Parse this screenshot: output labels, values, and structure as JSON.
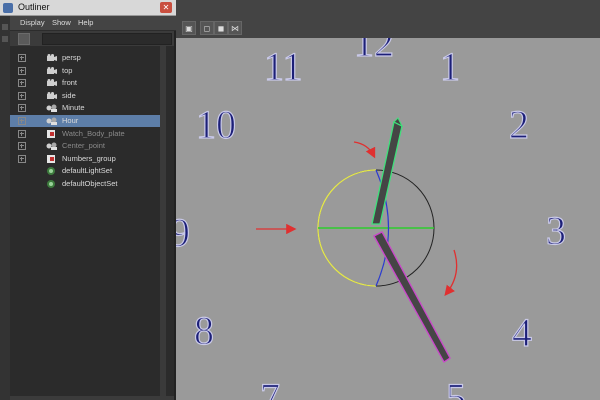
{
  "outliner": {
    "title": "Outliner",
    "close_glyph": "✕",
    "menu": [
      "Display",
      "Show",
      "Help"
    ],
    "items": [
      {
        "label": "persp",
        "icon": "camera-icon",
        "expandable": true,
        "selected": false,
        "dim": false
      },
      {
        "label": "top",
        "icon": "camera-icon",
        "expandable": true,
        "selected": false,
        "dim": false
      },
      {
        "label": "front",
        "icon": "camera-icon",
        "expandable": true,
        "selected": false,
        "dim": false
      },
      {
        "label": "side",
        "icon": "camera-icon",
        "expandable": true,
        "selected": false,
        "dim": false
      },
      {
        "label": "Minute",
        "icon": "mesh-group-icon",
        "expandable": true,
        "selected": false,
        "dim": false
      },
      {
        "label": "Hour",
        "icon": "mesh-group-icon",
        "expandable": true,
        "selected": true,
        "dim": false
      },
      {
        "label": "Watch_Body_plate",
        "icon": "mesh-icon",
        "expandable": true,
        "selected": false,
        "dim": true
      },
      {
        "label": "Center_point",
        "icon": "mesh-group-icon",
        "expandable": true,
        "selected": false,
        "dim": true
      },
      {
        "label": "Numbers_group",
        "icon": "mesh-icon",
        "expandable": true,
        "selected": false,
        "dim": false
      },
      {
        "label": "defaultLightSet",
        "icon": "set-icon",
        "expandable": false,
        "selected": false,
        "dim": false
      },
      {
        "label": "defaultObjectSet",
        "icon": "set-icon",
        "expandable": false,
        "selected": false,
        "dim": false
      }
    ]
  },
  "shelf": {
    "icons": [
      "select-icon",
      "cube-icon",
      "cube-icon",
      "network-icon"
    ]
  },
  "clock": {
    "numerals": [
      "12",
      "1",
      "2",
      "3",
      "4",
      "5",
      "7",
      "8",
      "9",
      "10",
      "11"
    ],
    "numeral_color": "#1c1f78",
    "hand_color": "#4a4a4a",
    "hour_hand_highlight": "#3ee07a",
    "minute_hand_highlight": "#cc44cc",
    "arrow_color": "#e03030"
  },
  "colors": {
    "viewport_bg": "#9a9a9a",
    "panel_bg": "#2b2b2b",
    "selection": "#5d7ea8"
  }
}
